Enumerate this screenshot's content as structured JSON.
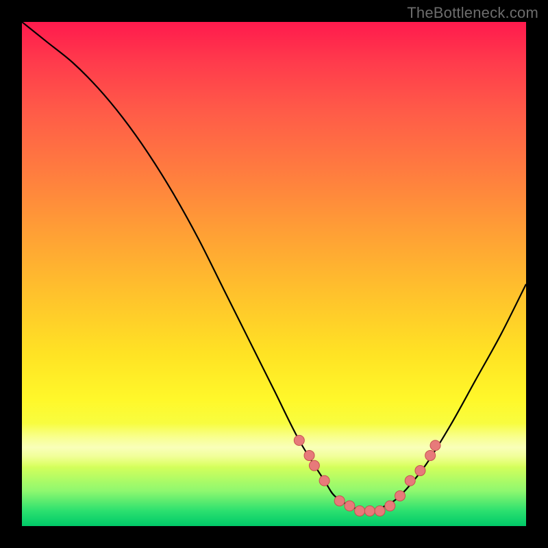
{
  "watermark": "TheBottleneck.com",
  "colors": {
    "background": "#000000",
    "curve": "#000000",
    "dot_fill": "#e77a7a",
    "dot_stroke": "#c65050"
  },
  "chart_data": {
    "type": "line",
    "title": "",
    "xlabel": "",
    "ylabel": "",
    "xlim": [
      0,
      100
    ],
    "ylim": [
      0,
      100
    ],
    "grid": false,
    "x": [
      0,
      5,
      10,
      15,
      20,
      25,
      30,
      35,
      40,
      45,
      50,
      55,
      60,
      62,
      65,
      68,
      70,
      72,
      75,
      80,
      85,
      90,
      95,
      100
    ],
    "values": [
      100,
      96,
      92,
      87,
      81,
      74,
      66,
      57,
      47,
      37,
      27,
      17,
      9,
      6,
      4,
      3,
      3,
      4,
      6,
      12,
      20,
      29,
      38,
      48
    ],
    "series_name": "bottleneck-curve",
    "dots": [
      {
        "x": 55,
        "y": 17
      },
      {
        "x": 57,
        "y": 14
      },
      {
        "x": 58,
        "y": 12
      },
      {
        "x": 60,
        "y": 9
      },
      {
        "x": 63,
        "y": 5
      },
      {
        "x": 65,
        "y": 4
      },
      {
        "x": 67,
        "y": 3
      },
      {
        "x": 69,
        "y": 3
      },
      {
        "x": 71,
        "y": 3
      },
      {
        "x": 73,
        "y": 4
      },
      {
        "x": 75,
        "y": 6
      },
      {
        "x": 77,
        "y": 9
      },
      {
        "x": 79,
        "y": 11
      },
      {
        "x": 81,
        "y": 14
      },
      {
        "x": 82,
        "y": 16
      }
    ]
  }
}
